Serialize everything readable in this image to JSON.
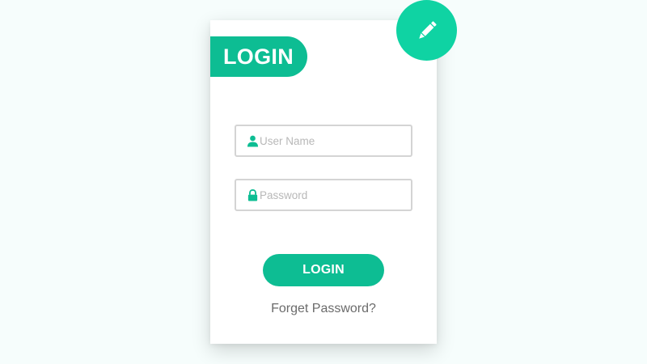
{
  "header": {
    "title": "LOGIN"
  },
  "fab": {
    "icon": "pencil-icon",
    "color": "#0fd3a3"
  },
  "form": {
    "username": {
      "icon": "user-icon",
      "value": "",
      "placeholder": "User Name"
    },
    "password": {
      "icon": "lock-icon",
      "value": "",
      "placeholder": "Password"
    },
    "submit_label": "LOGIN",
    "forgot_label": "Forget Password?"
  },
  "colors": {
    "accent": "#0dbd93",
    "background": "#f6fdfc",
    "card": "#ffffff",
    "muted_text": "#6b6b6b"
  }
}
